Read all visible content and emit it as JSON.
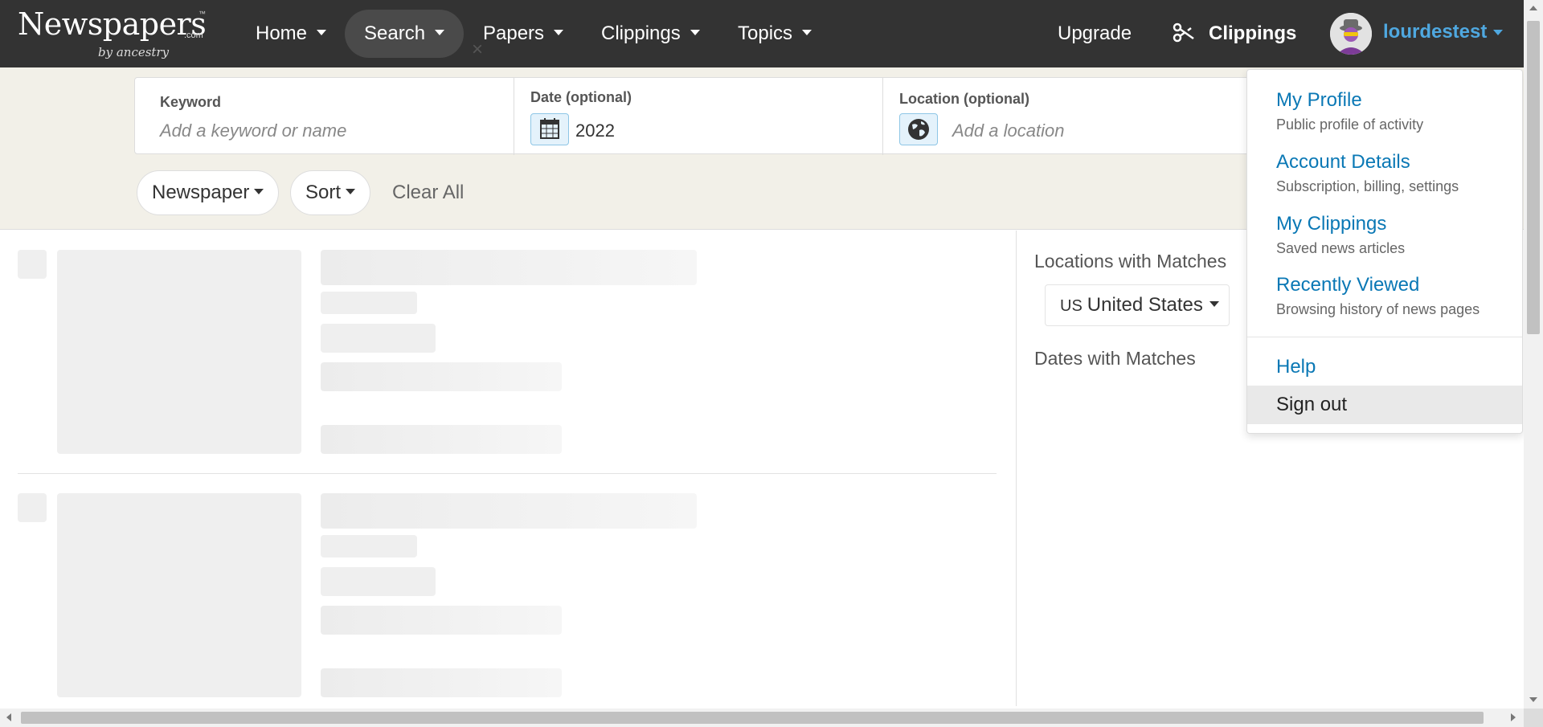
{
  "logo": {
    "brand": "Newspapers",
    "com": ".com",
    "tm": "™",
    "by": "by ancestry"
  },
  "nav": {
    "items": [
      {
        "label": "Home"
      },
      {
        "label": "Search"
      },
      {
        "label": "Papers"
      },
      {
        "label": "Clippings"
      },
      {
        "label": "Topics"
      }
    ],
    "upgrade": "Upgrade",
    "clippings": "Clippings",
    "username": "lourdestest"
  },
  "search": {
    "keyword_label": "Keyword",
    "keyword_placeholder": "Add a keyword or name",
    "date_label": "Date (optional)",
    "date_value": "2022",
    "clear_symbol": "×",
    "location_label": "Location (optional)",
    "location_placeholder": "Add a location"
  },
  "filters": {
    "newspaper": "Newspaper",
    "sort": "Sort",
    "clear_all": "Clear All"
  },
  "sidebar": {
    "locations_title": "Locations with Matches",
    "country_code": "US",
    "country_name": "United States",
    "dates_title": "Dates with Matches"
  },
  "user_menu": {
    "items": [
      {
        "title": "My Profile",
        "subtitle": "Public profile of activity"
      },
      {
        "title": "Account Details",
        "subtitle": "Subscription, billing, settings"
      },
      {
        "title": "My Clippings",
        "subtitle": "Saved news articles"
      },
      {
        "title": "Recently Viewed",
        "subtitle": "Browsing history of news pages"
      }
    ],
    "help": "Help",
    "sign_out": "Sign out"
  },
  "colors": {
    "topbar": "#333333",
    "link": "#0a78b5",
    "username": "#4fa8e0",
    "band": "#f2f0e8"
  }
}
